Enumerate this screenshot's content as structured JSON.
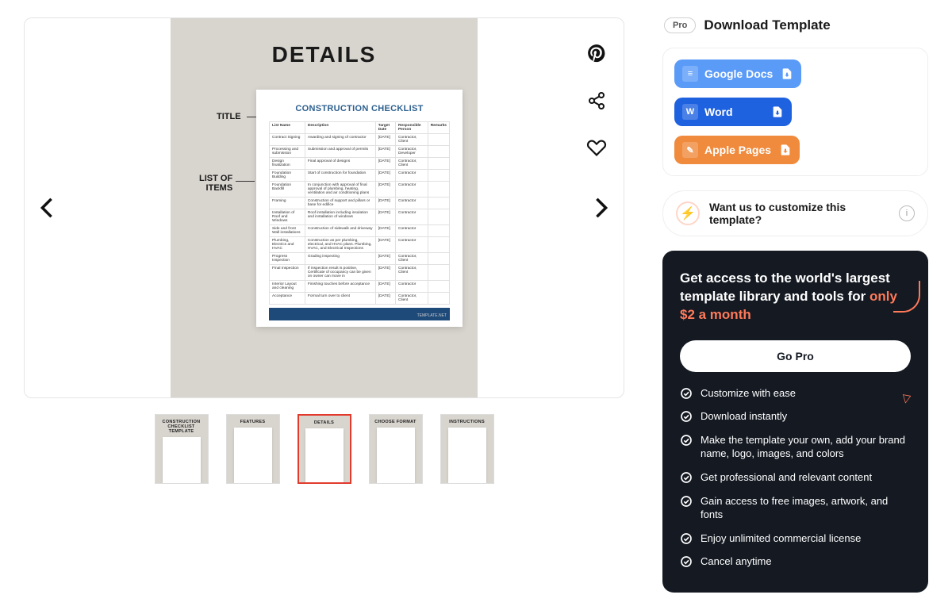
{
  "preview": {
    "heading": "DETAILS",
    "labels": {
      "title": "TITLE",
      "items": "LIST OF\nITEMS"
    },
    "doc_title": "CONSTRUCTION CHECKLIST",
    "columns": [
      "List Name",
      "Description",
      "Target Date",
      "Responsible Person",
      "Remarks"
    ],
    "rows": [
      {
        "name": "Contract Signing",
        "desc": "Awarding and signing of contractor",
        "date": "[DATE]",
        "person": "Contractor, Client",
        "remarks": ""
      },
      {
        "name": "Processing and submission",
        "desc": "Submission and approval of permits",
        "date": "[DATE]",
        "person": "Contractor, Developer",
        "remarks": ""
      },
      {
        "name": "Design finalization",
        "desc": "Final approval of designs",
        "date": "[DATE]",
        "person": "Contractor, Client",
        "remarks": ""
      },
      {
        "name": "Foundation Building",
        "desc": "Start of construction for foundation",
        "date": "[DATE]",
        "person": "Contractor",
        "remarks": ""
      },
      {
        "name": "Foundation Backfill",
        "desc": "In conjunction with approval of final approval of plumbing, heating, ventilation and air conditioning plans",
        "date": "[DATE]",
        "person": "Contractor",
        "remarks": ""
      },
      {
        "name": "Framing",
        "desc": "Construction of support and pillars or base for edifice",
        "date": "[DATE]",
        "person": "Contractor",
        "remarks": ""
      },
      {
        "name": "Installation of Roof and Windows",
        "desc": "Roof installation including insulation and installation of windows",
        "date": "[DATE]",
        "person": "Contractor",
        "remarks": ""
      },
      {
        "name": "Side and front Wall installations",
        "desc": "Construction of sidewalk and driveway",
        "date": "[DATE]",
        "person": "Contractor",
        "remarks": ""
      },
      {
        "name": "Plumbing, Electrics and HVAC",
        "desc": "Construction as per plumbing, electrical, and HVAC plans. Plumbing, HVAC, and Electrical Inspections",
        "date": "[DATE]",
        "person": "Contractor",
        "remarks": ""
      },
      {
        "name": "Progress Inspection",
        "desc": "Grading inspecting",
        "date": "[DATE]",
        "person": "Contractor, Client",
        "remarks": ""
      },
      {
        "name": "Final Inspection",
        "desc": "If inspection result is positive, Certificate of occupancy can be given on owner can move in",
        "date": "[DATE]",
        "person": "Contractor, Client",
        "remarks": ""
      },
      {
        "name": "Interior Layout and cleaning",
        "desc": "Finishing touches before acceptance",
        "date": "[DATE]",
        "person": "Contractor",
        "remarks": ""
      },
      {
        "name": "Acceptance",
        "desc": "Formal turn over to client",
        "date": "[DATE]",
        "person": "Contractor, Client",
        "remarks": ""
      }
    ],
    "footer_tag": "TEMPLATE.NET"
  },
  "thumbs": [
    {
      "title": "CONSTRUCTION CHECKLIST\nTEMPLATE",
      "active": false
    },
    {
      "title": "FEATURES",
      "active": false
    },
    {
      "title": "DETAILS",
      "active": true
    },
    {
      "title": "CHOOSE FORMAT",
      "active": false
    },
    {
      "title": "INSTRUCTIONS",
      "active": false
    }
  ],
  "download": {
    "pro": "Pro",
    "title": "Download Template",
    "formats": {
      "gdocs": "Google Docs",
      "word": "Word",
      "pages": "Apple Pages"
    }
  },
  "customize": {
    "text": "Want us to customize this template?"
  },
  "pro_card": {
    "headline_a": "Get access to the world's largest template library and tools for ",
    "headline_b": "only $2 a month",
    "cta": "Go Pro",
    "benefits": [
      "Customize with ease",
      "Download instantly",
      "Make the template your own, add your brand name, logo, images, and colors",
      "Get professional and relevant content",
      "Gain access to free images, artwork, and fonts",
      "Enjoy unlimited commercial license",
      "Cancel anytime"
    ]
  }
}
